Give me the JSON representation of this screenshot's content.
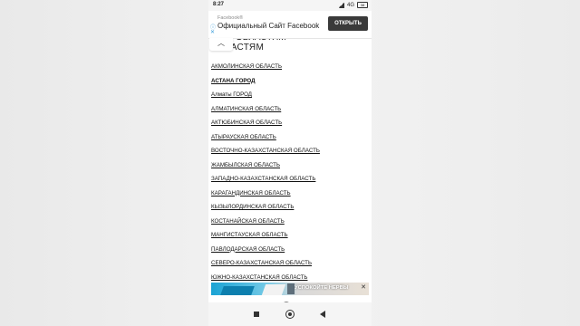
{
  "status": {
    "time": "8:27",
    "network": "4G",
    "battery": "38"
  },
  "ad_top": {
    "brand": "Facebook®",
    "headline": "Официальный Сайт Facebook",
    "cta_label": "ОТКРЫТЬ"
  },
  "page": {
    "heading": "ОБЛАСТЯМ",
    "regions": [
      "АКМОЛИНСКАЯ ОБЛАСТЬ",
      "АСТАНА ГОРОД",
      "Алматы ГОРОД",
      "АЛМАТИНСКАЯ ОБЛАСТЬ",
      "АКТЮБИНСКАЯ ОБЛАСТЬ",
      "АТЫРАУСКАЯ ОБЛАСТЬ",
      "ВОСТОЧНО-КАЗАХСТАНСКАЯ ОБЛАСТЬ",
      "ЖАМБЫЛСКАЯ ОБЛАСТЬ",
      "ЗАПАДНО-КАЗАХСТАНСКАЯ ОБЛАСТЬ",
      "КАРАГАНДИНСКАЯ ОБЛАСТЬ",
      "КЫЗЫЛОРДИНСКАЯ ОБЛАСТЬ",
      "КОСТАНАЙСКАЯ ОБЛАСТЬ",
      "МАНГИСТАУСКАЯ ОБЛАСТЬ",
      "ПАВЛОДАРСКАЯ ОБЛАСТЬ",
      "СЕВЕРО-КАЗАХСТАНСКАЯ ОБЛАСТЬ",
      "ЮЖНО-КАЗАХСТАНСКАЯ ОБЛАСТЬ"
    ]
  },
  "ad_bottom": {
    "text": "УСПОКОЙТЕ НЕРВЫ"
  },
  "icons": {
    "info": "info-icon",
    "close": "close-icon",
    "collapse": "chevron-up-icon",
    "nav_stop": "stop-icon",
    "nav_home": "home-icon",
    "nav_back": "back-icon"
  },
  "colors": {
    "accent": "#3b9edb",
    "cta_bg": "#3a3a3a"
  }
}
